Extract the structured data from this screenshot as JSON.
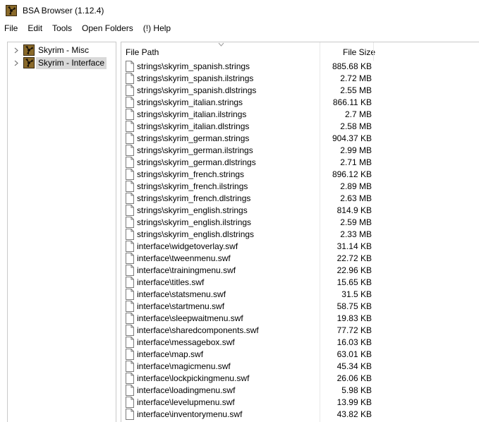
{
  "window": {
    "title": "BSA Browser (1.12.4)",
    "icon": "bsa-archive-icon"
  },
  "menu": [
    "File",
    "Edit",
    "Tools",
    "Open Folders",
    "(!) Help"
  ],
  "tree": [
    {
      "label": "Skyrim - Misc",
      "selected": false,
      "icon": "bsa-archive-icon"
    },
    {
      "label": "Skyrim - Interface",
      "selected": true,
      "icon": "bsa-archive-icon"
    }
  ],
  "columns": {
    "path": "File Path",
    "size": "File Size"
  },
  "files": [
    {
      "path": "strings\\skyrim_spanish.strings",
      "size": "885.68 KB"
    },
    {
      "path": "strings\\skyrim_spanish.ilstrings",
      "size": "2.72 MB"
    },
    {
      "path": "strings\\skyrim_spanish.dlstrings",
      "size": "2.55 MB"
    },
    {
      "path": "strings\\skyrim_italian.strings",
      "size": "866.11 KB"
    },
    {
      "path": "strings\\skyrim_italian.ilstrings",
      "size": "2.7 MB"
    },
    {
      "path": "strings\\skyrim_italian.dlstrings",
      "size": "2.58 MB"
    },
    {
      "path": "strings\\skyrim_german.strings",
      "size": "904.37 KB"
    },
    {
      "path": "strings\\skyrim_german.ilstrings",
      "size": "2.99 MB"
    },
    {
      "path": "strings\\skyrim_german.dlstrings",
      "size": "2.71 MB"
    },
    {
      "path": "strings\\skyrim_french.strings",
      "size": "896.12 KB"
    },
    {
      "path": "strings\\skyrim_french.ilstrings",
      "size": "2.89 MB"
    },
    {
      "path": "strings\\skyrim_french.dlstrings",
      "size": "2.63 MB"
    },
    {
      "path": "strings\\skyrim_english.strings",
      "size": "814.9 KB"
    },
    {
      "path": "strings\\skyrim_english.ilstrings",
      "size": "2.59 MB"
    },
    {
      "path": "strings\\skyrim_english.dlstrings",
      "size": "2.33 MB"
    },
    {
      "path": "interface\\widgetoverlay.swf",
      "size": "31.14 KB"
    },
    {
      "path": "interface\\tweenmenu.swf",
      "size": "22.72 KB"
    },
    {
      "path": "interface\\trainingmenu.swf",
      "size": "22.96 KB"
    },
    {
      "path": "interface\\titles.swf",
      "size": "15.65 KB"
    },
    {
      "path": "interface\\statsmenu.swf",
      "size": "31.5 KB"
    },
    {
      "path": "interface\\startmenu.swf",
      "size": "58.75 KB"
    },
    {
      "path": "interface\\sleepwaitmenu.swf",
      "size": "19.83 KB"
    },
    {
      "path": "interface\\sharedcomponents.swf",
      "size": "77.72 KB"
    },
    {
      "path": "interface\\messagebox.swf",
      "size": "16.03 KB"
    },
    {
      "path": "interface\\map.swf",
      "size": "63.01 KB"
    },
    {
      "path": "interface\\magicmenu.swf",
      "size": "45.34 KB"
    },
    {
      "path": "interface\\lockpickingmenu.swf",
      "size": "26.06 KB"
    },
    {
      "path": "interface\\loadingmenu.swf",
      "size": "5.98 KB"
    },
    {
      "path": "interface\\levelupmenu.swf",
      "size": "13.99 KB"
    },
    {
      "path": "interface\\inventorymenu.swf",
      "size": "43.82 KB"
    }
  ]
}
